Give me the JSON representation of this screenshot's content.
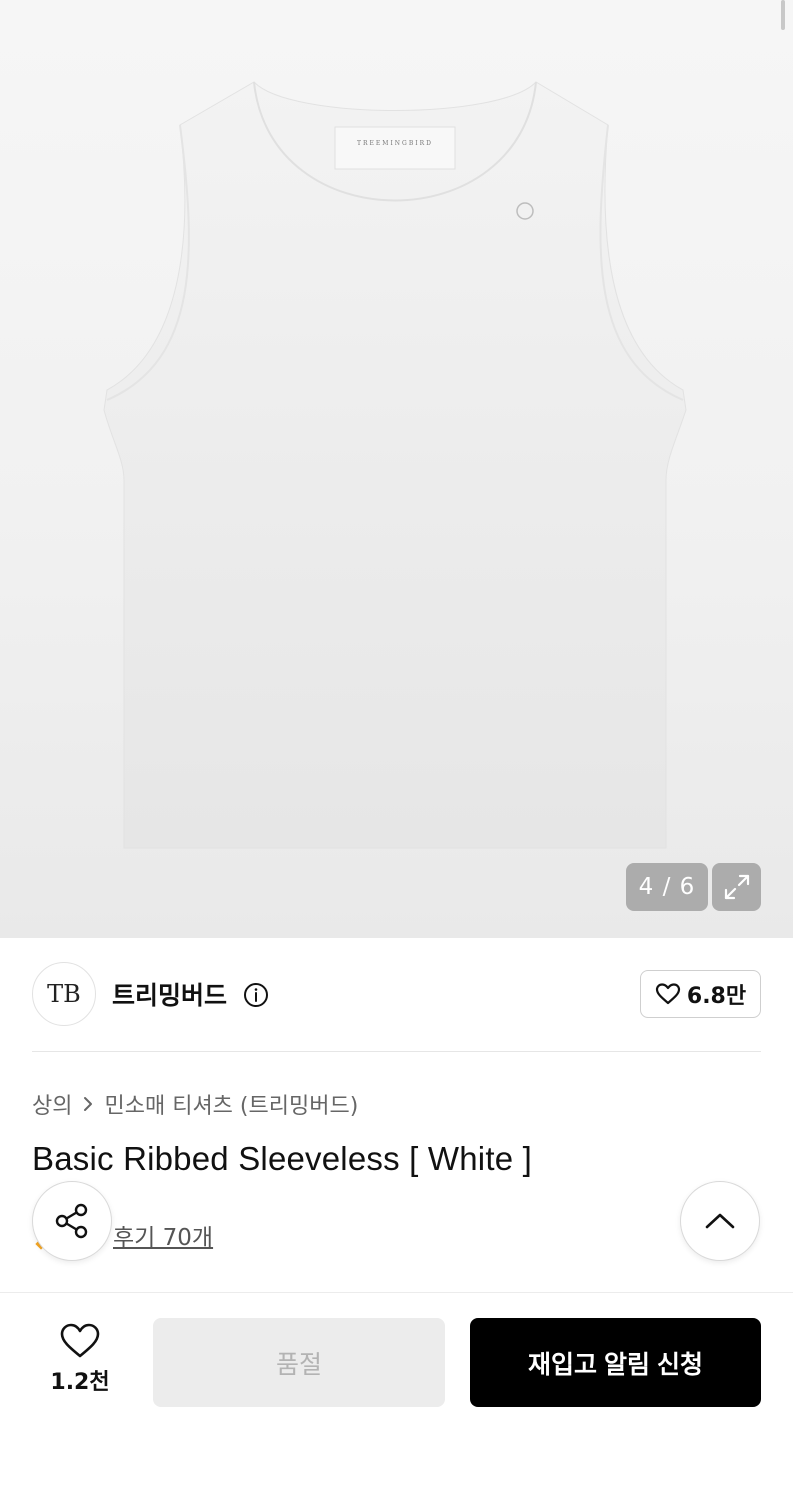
{
  "gallery": {
    "counter": "4 / 6",
    "garment_label": "TREEMINGBIRD"
  },
  "brand": {
    "logo_text": "TB",
    "name": "트리밍버드",
    "like_count": "6.8만"
  },
  "breadcrumb": {
    "category": "상의",
    "subcategory": "민소매 티셔츠 (트리밍버드)"
  },
  "product": {
    "title": "Basic Ribbed Sleeveless [ White ]",
    "review_link": "후기 70개"
  },
  "bottom_bar": {
    "wish_count": "1.2천",
    "soldout_label": "품절",
    "restock_label": "재입고 알림 신청"
  },
  "colors": {
    "primary_button": "#000000",
    "disabled_button": "#ececec",
    "star": "#f5a623"
  }
}
